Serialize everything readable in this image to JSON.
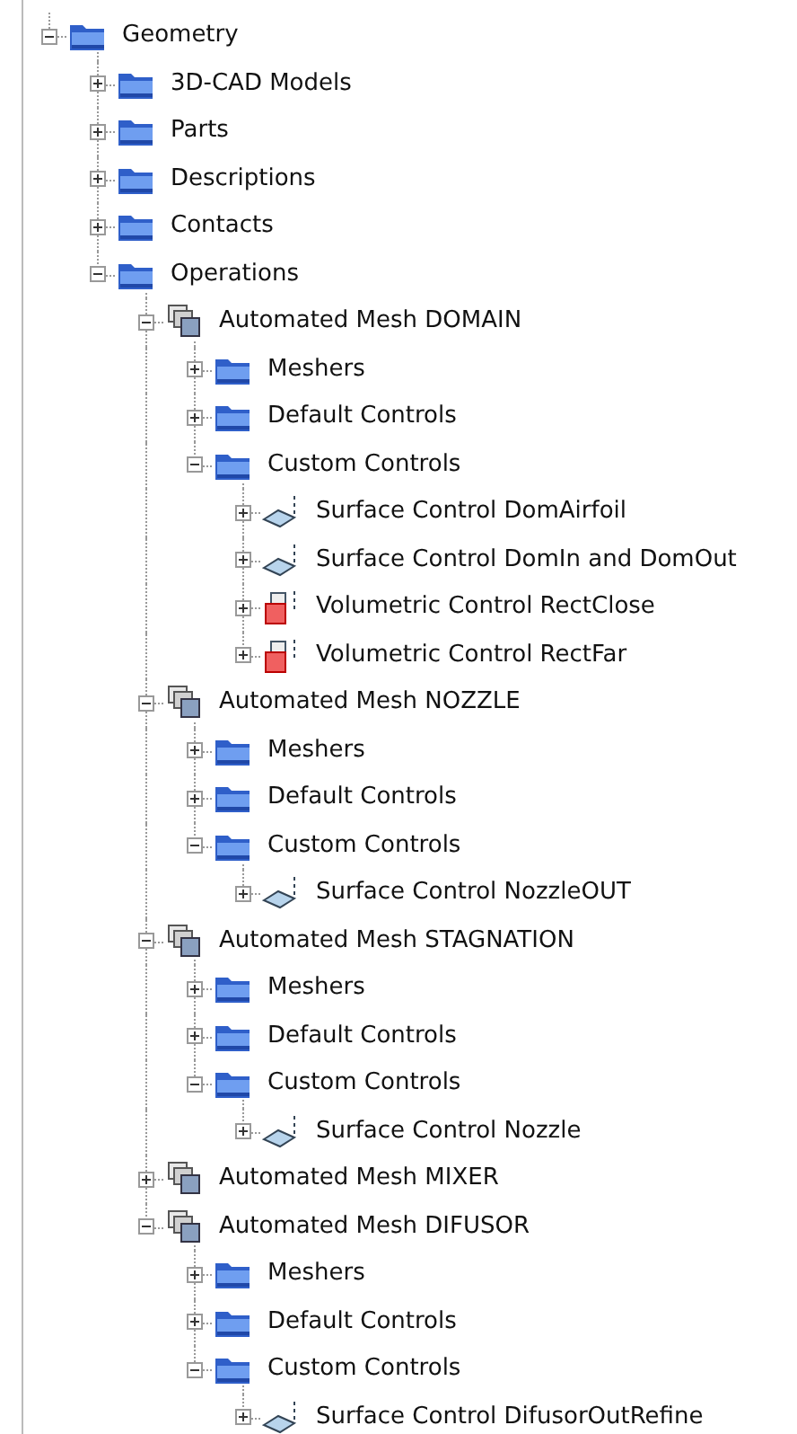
{
  "tree": [
    {
      "label": "Geometry",
      "kind": "folder",
      "expanded": true,
      "children": [
        {
          "label": "3D-CAD Models",
          "kind": "folder",
          "expanded": false
        },
        {
          "label": "Parts",
          "kind": "folder",
          "expanded": false
        },
        {
          "label": "Descriptions",
          "kind": "folder",
          "expanded": false
        },
        {
          "label": "Contacts",
          "kind": "folder",
          "expanded": false
        },
        {
          "label": "Operations",
          "kind": "folder",
          "expanded": true,
          "children": [
            {
              "label": "Automated Mesh DOMAIN",
              "kind": "mesh",
              "expanded": true,
              "children": [
                {
                  "label": "Meshers",
                  "kind": "folder",
                  "expanded": false
                },
                {
                  "label": "Default Controls",
                  "kind": "folder",
                  "expanded": false
                },
                {
                  "label": "Custom Controls",
                  "kind": "folder",
                  "expanded": true,
                  "children": [
                    {
                      "label": "Surface Control DomAirfoil",
                      "kind": "surface",
                      "expanded": false
                    },
                    {
                      "label": "Surface Control DomIn and DomOut",
                      "kind": "surface",
                      "expanded": false
                    },
                    {
                      "label": "Volumetric Control RectClose",
                      "kind": "volume",
                      "expanded": false
                    },
                    {
                      "label": "Volumetric Control RectFar",
                      "kind": "volume",
                      "expanded": false
                    }
                  ]
                }
              ]
            },
            {
              "label": "Automated Mesh NOZZLE",
              "kind": "mesh",
              "expanded": true,
              "children": [
                {
                  "label": "Meshers",
                  "kind": "folder",
                  "expanded": false
                },
                {
                  "label": "Default Controls",
                  "kind": "folder",
                  "expanded": false
                },
                {
                  "label": "Custom Controls",
                  "kind": "folder",
                  "expanded": true,
                  "children": [
                    {
                      "label": "Surface Control NozzleOUT",
                      "kind": "surface",
                      "expanded": false
                    }
                  ]
                }
              ]
            },
            {
              "label": "Automated Mesh STAGNATION",
              "kind": "mesh",
              "expanded": true,
              "children": [
                {
                  "label": "Meshers",
                  "kind": "folder",
                  "expanded": false
                },
                {
                  "label": "Default Controls",
                  "kind": "folder",
                  "expanded": false
                },
                {
                  "label": "Custom Controls",
                  "kind": "folder",
                  "expanded": true,
                  "children": [
                    {
                      "label": "Surface Control Nozzle",
                      "kind": "surface",
                      "expanded": false
                    }
                  ]
                }
              ]
            },
            {
              "label": "Automated Mesh MIXER",
              "kind": "mesh",
              "expanded": false
            },
            {
              "label": "Automated Mesh DIFUSOR",
              "kind": "mesh",
              "expanded": true,
              "children": [
                {
                  "label": "Meshers",
                  "kind": "folder",
                  "expanded": false
                },
                {
                  "label": "Default Controls",
                  "kind": "folder",
                  "expanded": false
                },
                {
                  "label": "Custom Controls",
                  "kind": "folder",
                  "expanded": true,
                  "children": [
                    {
                      "label": "Surface Control DifusorOutRefine",
                      "kind": "surface",
                      "expanded": false
                    }
                  ]
                }
              ]
            }
          ]
        }
      ]
    }
  ]
}
